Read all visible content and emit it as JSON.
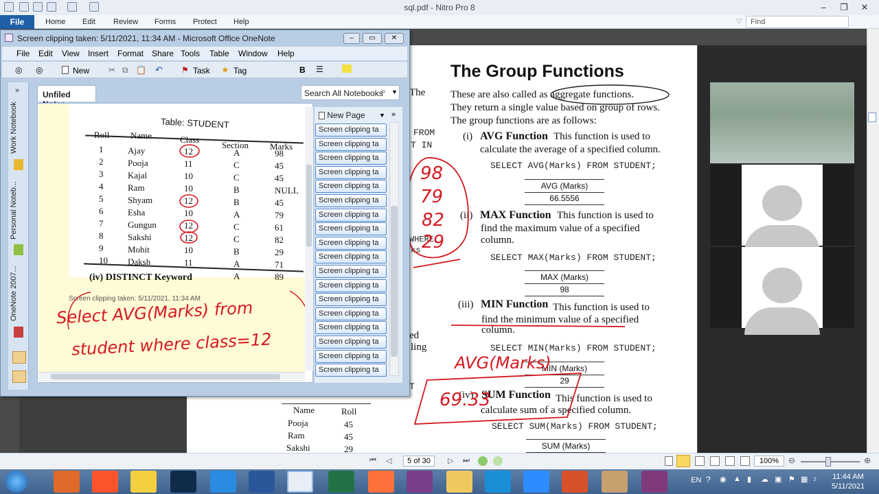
{
  "nitro": {
    "title": "sql.pdf - Nitro Pro 8",
    "file_tab": "File",
    "tabs": [
      "Home",
      "Edit",
      "Review",
      "Forms",
      "Protect",
      "Help"
    ],
    "find_placeholder": "Find",
    "page_indicator": "5 of 30",
    "zoom": "100%"
  },
  "onenote": {
    "title": "Screen clipping taken: 5/11/2021, 11:34 AM - Microsoft Office OneNote",
    "menu": [
      "File",
      "Edit",
      "View",
      "Insert",
      "Format",
      "Share",
      "Tools",
      "Table",
      "Window",
      "Help"
    ],
    "toolbar": {
      "new": "New",
      "task": "Task",
      "tag": "Tag"
    },
    "side_tabs": [
      "Work Notebook",
      "Personal Noteb...",
      "OneNote 2007..."
    ],
    "section_tab": "Unfiled Notes",
    "search_placeholder": "Search All Notebooks",
    "new_page": "New Page",
    "page_items": [
      "Screen clipping ta",
      "Screen clipping ta",
      "Screen clipping ta",
      "Screen clipping ta",
      "Screen clipping ta",
      "Screen clipping ta",
      "Screen clipping ta",
      "Screen clipping ta",
      "Screen clipping ta",
      "Screen clipping ta",
      "Screen clipping ta",
      "Screen clipping ta",
      "Screen clipping ta",
      "Screen clipping ta",
      "Screen clipping ta",
      "Screen clipping ta",
      "Screen clipping ta",
      "Screen clipping ta"
    ],
    "clip_caption": "Screen clipping taken: 5/11/2021, 11:34 AM",
    "note_table": {
      "title": "Table: STUDENT",
      "headers": [
        "Roll",
        "Name",
        "Class",
        "Section",
        "Marks"
      ],
      "rows": [
        [
          "1",
          "Ajay",
          "12",
          "A",
          "98"
        ],
        [
          "2",
          "Pooja",
          "11",
          "C",
          "45"
        ],
        [
          "3",
          "Kajal",
          "10",
          "C",
          "45"
        ],
        [
          "4",
          "Ram",
          "10",
          "B",
          "NULL"
        ],
        [
          "5",
          "Shyam",
          "12",
          "B",
          "45"
        ],
        [
          "6",
          "Esha",
          "10",
          "A",
          "79"
        ],
        [
          "7",
          "Gungun",
          "12",
          "C",
          "61"
        ],
        [
          "8",
          "Sakshi",
          "12",
          "C",
          "82"
        ],
        [
          "9",
          "Mohit",
          "10",
          "B",
          "29"
        ],
        [
          "10",
          "Daksh",
          "11",
          "A",
          "71"
        ],
        [
          "",
          "",
          "",
          "A",
          "89"
        ]
      ],
      "footer": "(iv) DISTINCT Keyword"
    },
    "handwriting": [
      "Select AVG(Marks) from",
      "student where class=12"
    ]
  },
  "pdf_page": {
    "heading": "The Group Functions",
    "intro": [
      "These are also called as aggregate functions.",
      "They return a single value based on group of rows.",
      "The group functions are as follows:"
    ],
    "sections": [
      {
        "label": "(i)",
        "name": "AVG Function",
        "desc1": "This function is used to",
        "desc2": "calculate the average of a specified column.",
        "sql": "SELECT AVG(Marks) FROM STUDENT;",
        "result_header": "AVG (Marks)",
        "result_value": "66.5556"
      },
      {
        "label": "(ii)",
        "name": "MAX Function",
        "desc1": "This function is used to",
        "desc2": "find the maximum value of a specified",
        "desc3": "column.",
        "sql": "SELECT MAX(Marks) FROM  STUDENT;",
        "result_header": "MAX (Marks)",
        "result_value": "98"
      },
      {
        "label": "(iii)",
        "name": "MIN Function",
        "desc1": "This function is used to",
        "desc2": "find the minimum value of a specified",
        "desc3": "column.",
        "sql": "SELECT MIN(Marks) FROM STUDENT;",
        "result_header": "MIN (Marks)",
        "result_value": "29"
      },
      {
        "label": "(iv)",
        "name": "SUM Function",
        "desc1": "This function is used to",
        "desc2": "calculate sum of a specified column.",
        "sql": "SELECT SUM(Marks) FROM STUDENT;",
        "result_header": "SUM (Marks)"
      }
    ],
    "left_fragments": [
      "The",
      "FROM",
      "T IN",
      "WHERE",
      "ks",
      "ed",
      "ling",
      "T"
    ],
    "bottom_table": {
      "headers": [
        "Name",
        "Roll"
      ],
      "rows": [
        [
          "Pooja",
          "45"
        ],
        [
          "Ram",
          "45"
        ],
        [
          "Sakshi",
          "29"
        ]
      ]
    },
    "red_numbers": [
      "98",
      "79",
      "82",
      "29"
    ],
    "red_annotation": [
      "AVG(Marks)",
      "69.33"
    ]
  },
  "taskbar": {
    "lang": "EN",
    "time": "11:44 AM",
    "date": "5/11/2021"
  },
  "colors": {
    "accent": "#1f5fa8",
    "ink": "#d4181f"
  }
}
